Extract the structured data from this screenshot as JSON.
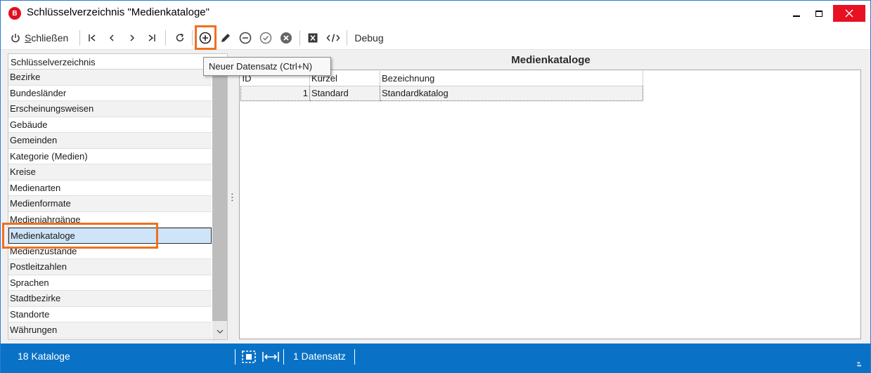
{
  "window": {
    "title": "Schlüsselverzeichnis \"Medienkataloge\"",
    "app_icon_letter": "B",
    "app_icon_color": "#e01020"
  },
  "toolbar": {
    "close_label_prefix": "",
    "close_label_underlined": "S",
    "close_label_rest": "chließen",
    "debug_label": "Debug",
    "icons": [
      "power-icon",
      "first-icon",
      "previous-icon",
      "next-icon",
      "last-icon",
      "refresh-icon",
      "add-icon",
      "edit-icon",
      "remove-icon",
      "confirm-icon",
      "cancel-icon",
      "excel-icon",
      "code-icon"
    ]
  },
  "tooltip": {
    "text": "Neuer Datensatz (Ctrl+N)"
  },
  "left_list": {
    "header": "Schlüsselverzeichnis",
    "items": [
      {
        "label": "Bezirke"
      },
      {
        "label": "Bundesländer"
      },
      {
        "label": "Erscheinungsweisen"
      },
      {
        "label": "Gebäude"
      },
      {
        "label": "Gemeinden"
      },
      {
        "label": "Kategorie (Medien)"
      },
      {
        "label": "Kreise"
      },
      {
        "label": "Medienarten"
      },
      {
        "label": "Medienformate"
      },
      {
        "label": "Medienjahrgänge"
      },
      {
        "label": "Medienkataloge"
      },
      {
        "label": "Medienzustände"
      },
      {
        "label": "Postleitzahlen"
      },
      {
        "label": "Sprachen"
      },
      {
        "label": "Stadtbezirke"
      },
      {
        "label": "Standorte"
      },
      {
        "label": "Währungen"
      }
    ],
    "selected_index": 10
  },
  "main": {
    "title": "Medienkataloge",
    "columns": [
      "ID",
      "Kürzel",
      "Bezeichnung"
    ],
    "rows": [
      {
        "id": "1",
        "kuerzel": "Standard",
        "bezeichnung": "Standardkatalog"
      }
    ]
  },
  "statusbar": {
    "left": "18 Kataloge",
    "right": "1 Datensatz"
  },
  "colors": {
    "accent": "#0a72c6",
    "highlight": "#f07020",
    "close_button": "#e81123",
    "selection": "#cfe4f8"
  }
}
